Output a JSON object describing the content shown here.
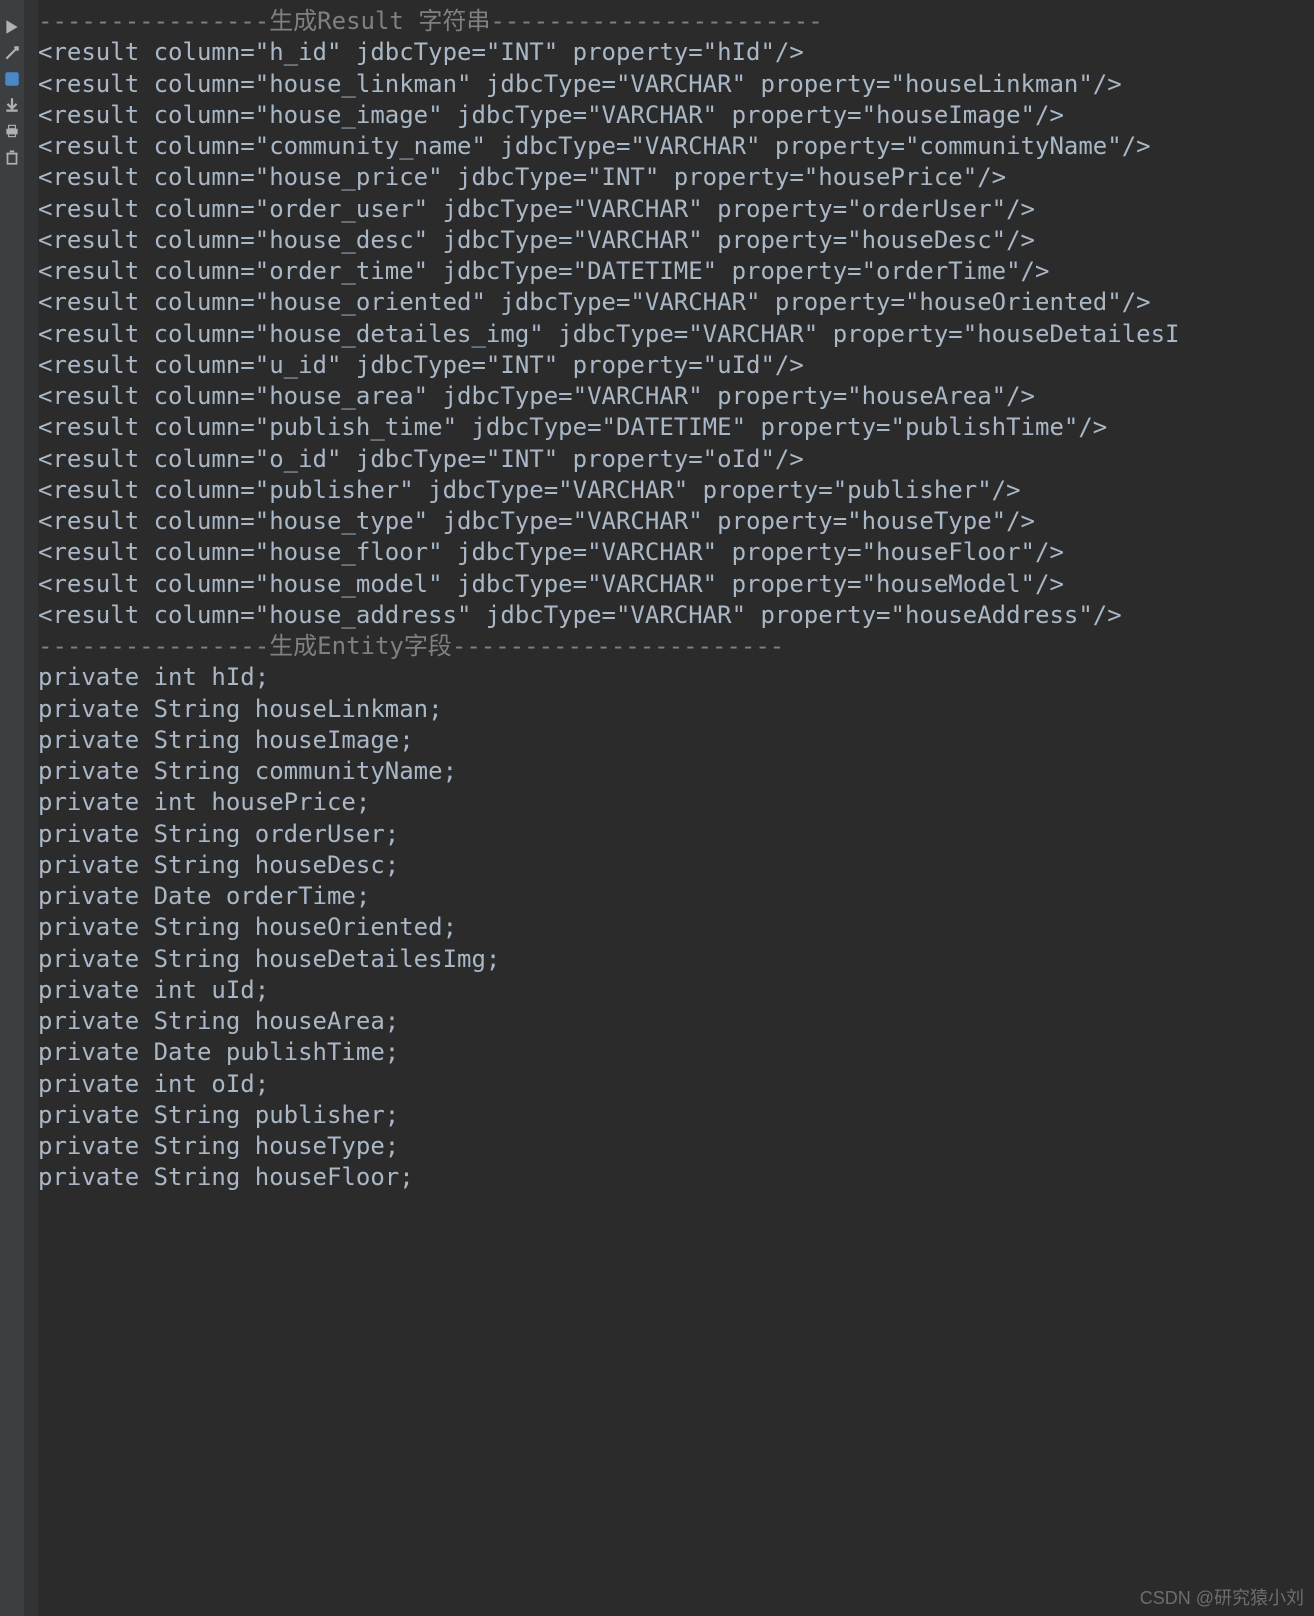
{
  "comments": {
    "result_header": "----------------生成Result 字符串-----------------------",
    "entity_header": "----------------生成Entity字段-----------------------"
  },
  "result_lines": [
    "<result column=\"h_id\" jdbcType=\"INT\" property=\"hId\"/>",
    "<result column=\"house_linkman\" jdbcType=\"VARCHAR\" property=\"houseLinkman\"/>",
    "<result column=\"house_image\" jdbcType=\"VARCHAR\" property=\"houseImage\"/>",
    "<result column=\"community_name\" jdbcType=\"VARCHAR\" property=\"communityName\"/>",
    "<result column=\"house_price\" jdbcType=\"INT\" property=\"housePrice\"/>",
    "<result column=\"order_user\" jdbcType=\"VARCHAR\" property=\"orderUser\"/>",
    "<result column=\"house_desc\" jdbcType=\"VARCHAR\" property=\"houseDesc\"/>",
    "<result column=\"order_time\" jdbcType=\"DATETIME\" property=\"orderTime\"/>",
    "<result column=\"house_oriented\" jdbcType=\"VARCHAR\" property=\"houseOriented\"/>",
    "<result column=\"house_detailes_img\" jdbcType=\"VARCHAR\" property=\"houseDetailesI",
    "<result column=\"u_id\" jdbcType=\"INT\" property=\"uId\"/>",
    "<result column=\"house_area\" jdbcType=\"VARCHAR\" property=\"houseArea\"/>",
    "<result column=\"publish_time\" jdbcType=\"DATETIME\" property=\"publishTime\"/>",
    "<result column=\"o_id\" jdbcType=\"INT\" property=\"oId\"/>",
    "<result column=\"publisher\" jdbcType=\"VARCHAR\" property=\"publisher\"/>",
    "<result column=\"house_type\" jdbcType=\"VARCHAR\" property=\"houseType\"/>",
    "<result column=\"house_floor\" jdbcType=\"VARCHAR\" property=\"houseFloor\"/>",
    "<result column=\"house_model\" jdbcType=\"VARCHAR\" property=\"houseModel\"/>",
    "<result column=\"house_address\" jdbcType=\"VARCHAR\" property=\"houseAddress\"/>"
  ],
  "entity_lines": [
    "private int hId;",
    "private String houseLinkman;",
    "private String houseImage;",
    "private String communityName;",
    "private int housePrice;",
    "private String orderUser;",
    "private String houseDesc;",
    "private Date orderTime;",
    "private String houseOriented;",
    "private String houseDetailesImg;",
    "private int uId;",
    "private String houseArea;",
    "private Date publishTime;",
    "private int oId;",
    "private String publisher;",
    "private String houseType;",
    "private String houseFloor;"
  ],
  "watermark": "CSDN @研究猿小刘",
  "sidebar_icons": [
    "run-icon",
    "debug-icon",
    "tool1-icon",
    "download-icon",
    "print-icon",
    "trash-icon"
  ]
}
